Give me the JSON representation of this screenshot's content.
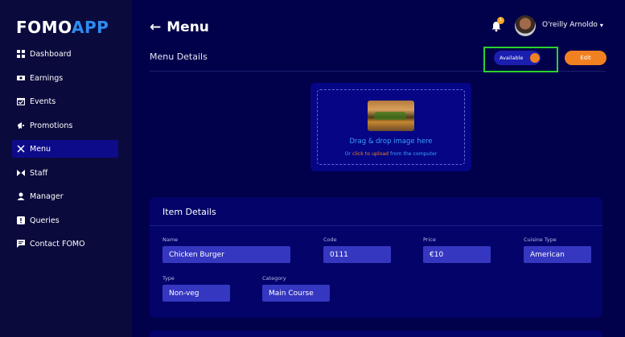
{
  "brand": {
    "logo_part1": "FOMO",
    "logo_part2": "APP"
  },
  "sidebar": {
    "items": [
      {
        "label": "Dashboard",
        "icon": "grid-icon",
        "active": false
      },
      {
        "label": "Earnings",
        "icon": "cash-icon",
        "active": false
      },
      {
        "label": "Events",
        "icon": "calendar-check-icon",
        "active": false
      },
      {
        "label": "Promotions",
        "icon": "megaphone-icon",
        "active": false
      },
      {
        "label": "Menu",
        "icon": "utensils-icon",
        "active": true
      },
      {
        "label": "Staff",
        "icon": "staff-icon",
        "active": false
      },
      {
        "label": "Manager",
        "icon": "manager-icon",
        "active": false
      },
      {
        "label": "Queries",
        "icon": "alert-icon",
        "active": false
      },
      {
        "label": "Contact FOMO",
        "icon": "chat-icon",
        "active": false
      }
    ]
  },
  "header": {
    "title": "Menu",
    "user_name": "O'reilly Arnoldo",
    "notification_count": "1"
  },
  "menu_details": {
    "section_title": "Menu Details",
    "availability_label": "Available",
    "edit_label": "Edit"
  },
  "upload": {
    "title": "Drag & drop image here",
    "sub_prefix": "Or ",
    "sub_link": "click to upload",
    "sub_suffix": " from the computer"
  },
  "item_details": {
    "title": "Item Details",
    "fields": {
      "name": {
        "label": "Name",
        "value": "Chicken Burger"
      },
      "code": {
        "label": "Code",
        "value": "0111"
      },
      "price": {
        "label": "Price",
        "value": "€10"
      },
      "cuisine": {
        "label": "Cuisine Type",
        "value": "American"
      },
      "type": {
        "label": "Type",
        "value": "Non-veg"
      },
      "category": {
        "label": "Category",
        "value": "Main Course"
      }
    }
  },
  "colors": {
    "sidebar_bg": "#0b0a3d",
    "main_bg": "#01004a",
    "accent_orange": "#f18020",
    "accent_blue": "#2d8cf0",
    "highlight_green": "#2bd32b"
  }
}
